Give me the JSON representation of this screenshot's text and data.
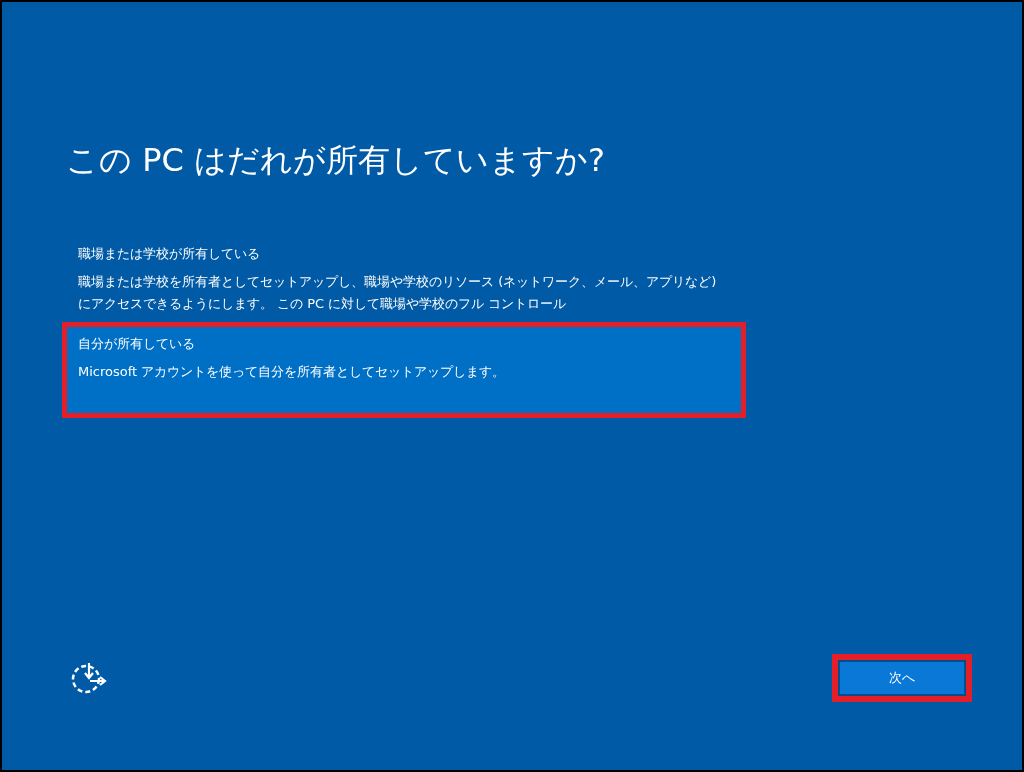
{
  "title": "この PC はだれが所有していますか?",
  "options": [
    {
      "label": "職場または学校が所有している",
      "description": "職場または学校を所有者としてセットアップし、職場や学校のリソース (ネットワーク、メール、アプリなど) にアクセスできるようにします。 この PC に対して職場や学校のフル コントロール",
      "selected": false,
      "highlighted": false
    },
    {
      "label": "自分が所有している",
      "description": "Microsoft アカウントを使って自分を所有者としてセットアップします。",
      "selected": true,
      "highlighted": true
    }
  ],
  "next_button": {
    "label": "次へ",
    "highlighted": true
  }
}
